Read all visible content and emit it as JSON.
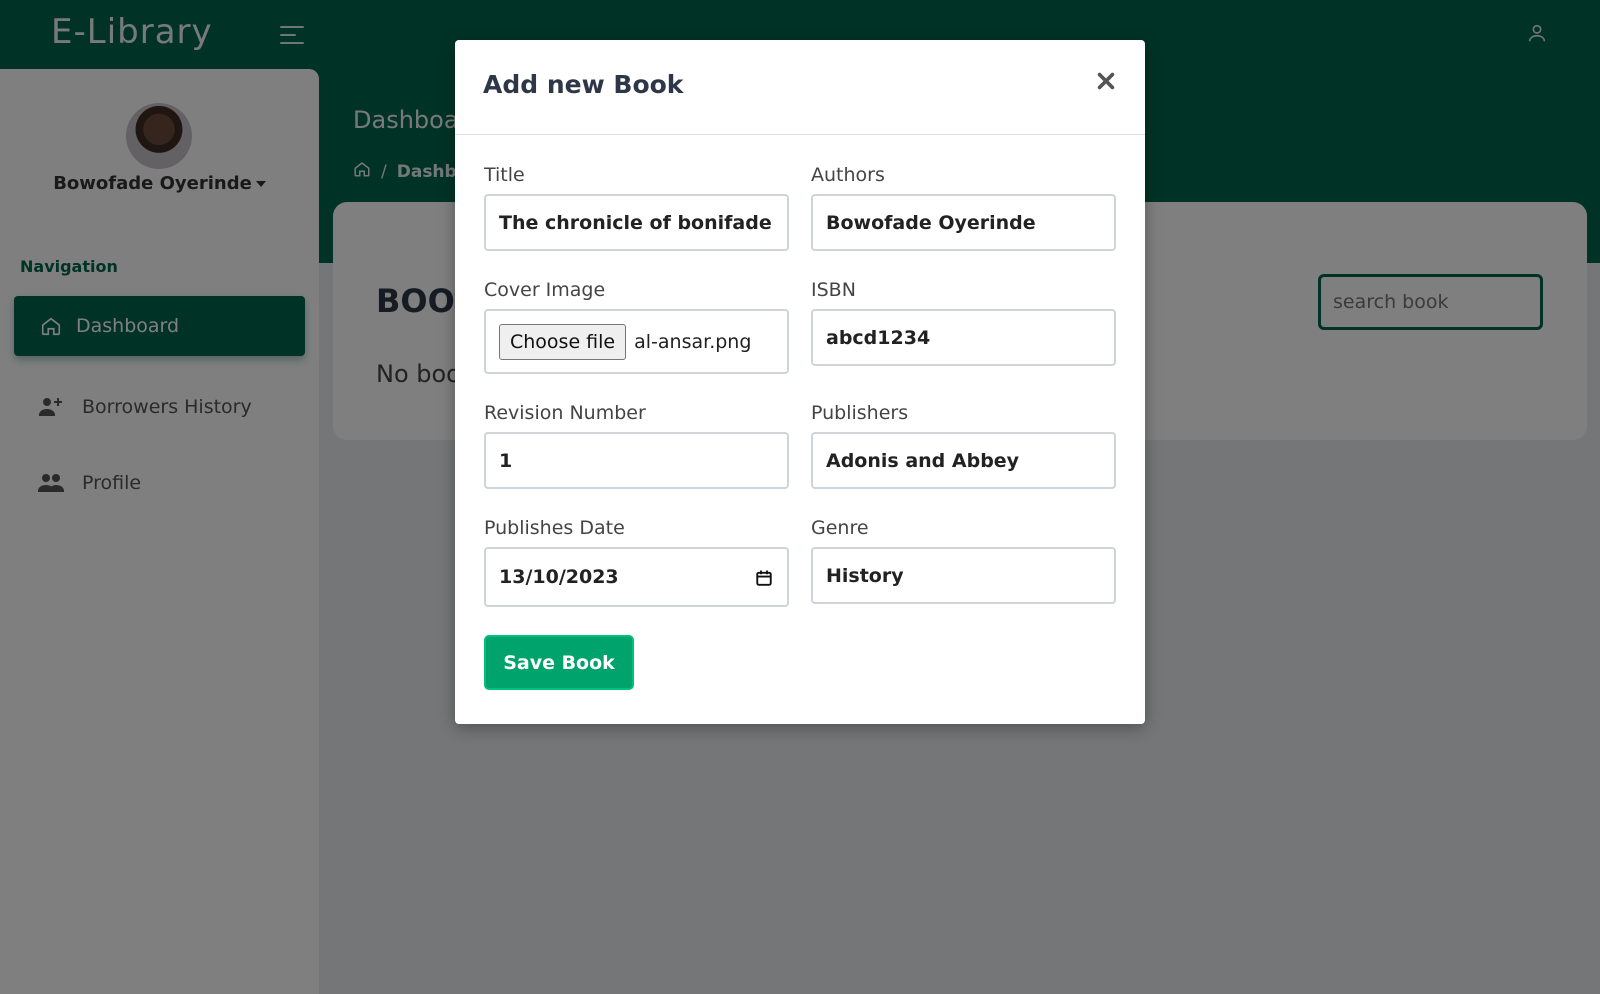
{
  "app": {
    "brand": "E-Library"
  },
  "sidebar": {
    "username": "Bowofade Oyerinde",
    "nav_title": "Navigation",
    "items": [
      {
        "label": "Dashboard",
        "icon": "home-icon",
        "active": true
      },
      {
        "label": "Borrowers History",
        "icon": "user-plus-icon"
      },
      {
        "label": "Profile",
        "icon": "users-icon"
      }
    ]
  },
  "main": {
    "page_title": "Dashboard",
    "breadcrumb": [
      "Dashboard"
    ],
    "card_title": "BOOKS",
    "search_placeholder": "search book",
    "empty_text": "No books"
  },
  "modal": {
    "title": "Add new Book",
    "close_icon": "close-icon",
    "fields": {
      "title": {
        "label": "Title",
        "value": "The chronicle of bonifade"
      },
      "authors": {
        "label": "Authors",
        "value": "Bowofade Oyerinde"
      },
      "cover": {
        "label": "Cover Image",
        "button": "Choose file",
        "file": "al-ansar.png"
      },
      "isbn": {
        "label": "ISBN",
        "value": "abcd1234"
      },
      "revision": {
        "label": "Revision Number",
        "value": "1"
      },
      "publishers": {
        "label": "Publishers",
        "value": "Adonis and Abbey"
      },
      "date": {
        "label": "Publishes Date",
        "value": "13/10/2023"
      },
      "genre": {
        "label": "Genre",
        "value": "History"
      }
    },
    "save_label": "Save Book"
  },
  "colors": {
    "primary": "#01674a",
    "accent": "#00a36c"
  }
}
